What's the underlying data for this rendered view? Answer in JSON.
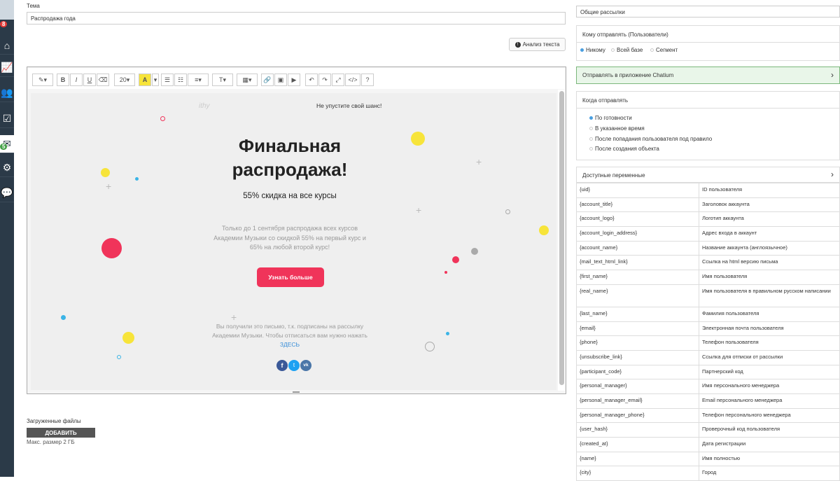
{
  "sidebar": {
    "badge_top": "8",
    "badge_mail": "5",
    "icons": [
      "home-icon",
      "chart-icon",
      "users-icon",
      "checkbox-icon",
      "mail-icon",
      "settings-icon",
      "chat-icon"
    ]
  },
  "form": {
    "subject_label": "Тема",
    "subject_value": "Распродажа года",
    "analyze_button": "Анализ текста",
    "uploaded_label": "Загруженные файлы",
    "add_button": "ДОБАВИТЬ",
    "max_size": "Макс. размер 2 ГБ"
  },
  "toolbar": {
    "font_size": "20",
    "bold": "B",
    "italic": "I",
    "underline": "U",
    "text_type": "T",
    "help": "?"
  },
  "email": {
    "brand": "ithy",
    "top_note": "Не упустите свой шанс!",
    "headline_1": "Финальная",
    "headline_2": "распродажа!",
    "subheadline": "55% скидка на все курсы",
    "body_1": "Только до 1 сентября распродажа всех курсов",
    "body_2": "Академии Музыки со скидкой 55% на первый курс и",
    "body_3": "65% на любой второй курс!",
    "cta": "Узнать больше",
    "footer_1": "Вы получили это письмо, т.к. подписаны на рассылку",
    "footer_2": "Академии Музыки. Чтобы отписаться вам нужно нажать",
    "footer_link": "ЗДЕСЬ"
  },
  "right": {
    "category_select": "Общие рассылки",
    "recipients_title": "Кому отправлять (Пользователи)",
    "recipients_options": [
      "Никому",
      "Всей базе",
      "Сегмент"
    ],
    "app_send": "Отправлять в приложение Chatium",
    "when_title": "Когда отправлять",
    "when_options": [
      "По готовности",
      "В указанное время",
      "После попадания пользователя под правило",
      "После создания объекта"
    ],
    "vars_title": "Доступные переменные"
  },
  "variables": [
    {
      "key": "{uid}",
      "desc": "ID пользователя"
    },
    {
      "key": "{account_title}",
      "desc": "Заголовок аккаунта"
    },
    {
      "key": "{account_logo}",
      "desc": "Логотип аккаунта"
    },
    {
      "key": "{account_login_address}",
      "desc": "Адрес входа в аккаунт"
    },
    {
      "key": "{account_name}",
      "desc": "Название аккаунта (англоязычное)"
    },
    {
      "key": "{mail_text_html_link}",
      "desc": "Ссылка на html версию письма"
    },
    {
      "key": "{first_name}",
      "desc": "Имя пользователя"
    },
    {
      "key": "{real_name}",
      "desc": "Имя пользователя в правильном русском написании"
    },
    {
      "key": "{last_name}",
      "desc": "Фамилия пользователя"
    },
    {
      "key": "{email}",
      "desc": "Электронная почта пользователя"
    },
    {
      "key": "{phone}",
      "desc": "Телефон пользователя"
    },
    {
      "key": "{unsubscribe_link}",
      "desc": "Ссылка для отписки от рассылки"
    },
    {
      "key": "{participant_code}",
      "desc": "Партнерский код"
    },
    {
      "key": "{personal_manager}",
      "desc": "Имя персонального менеджера"
    },
    {
      "key": "{personal_manager_email}",
      "desc": "Email персонального менеджера"
    },
    {
      "key": "{personal_manager_phone}",
      "desc": "Телефон персонального менеджера"
    },
    {
      "key": "{user_hash}",
      "desc": "Проверочный код пользователя"
    },
    {
      "key": "{created_at}",
      "desc": "Дата регистрации"
    },
    {
      "key": "{name}",
      "desc": "Имя полностью"
    },
    {
      "key": "{city}",
      "desc": "Город"
    }
  ],
  "colors": {
    "sidebar": "#2b3a48",
    "cta": "#f0345a",
    "yellow": "#f7e43a",
    "red": "#f0345a",
    "blue": "#3bb4e6",
    "app_panel": "#e9f6e9"
  }
}
